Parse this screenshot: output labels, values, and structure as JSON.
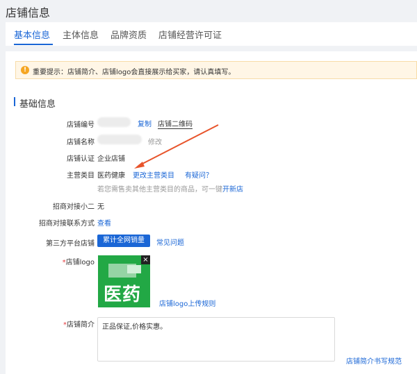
{
  "page": {
    "title": "店铺信息"
  },
  "tabs": [
    {
      "label": "基本信息"
    },
    {
      "label": "主体信息"
    },
    {
      "label": "品牌资质"
    },
    {
      "label": "店铺经营许可证"
    }
  ],
  "notice": {
    "text": "重要提示：店铺简介、店铺logo会直接展示给买家，请认真填写。"
  },
  "section": {
    "title": "基础信息"
  },
  "fields": {
    "shop_id": {
      "label": "店铺编号",
      "copy": "复制",
      "qrcode": "店铺二维码"
    },
    "shop_name": {
      "label": "店铺名称",
      "edit": "修改"
    },
    "shop_cert": {
      "label": "店铺认证",
      "value": "企业店铺"
    },
    "main_category": {
      "label": "主营类目",
      "value": "医药健康",
      "change": "更改主营类目",
      "question": "有疑问？",
      "hint": "若您需售卖其他主营类目的商品，可一键",
      "hint_link": "开新店"
    },
    "contact_staff": {
      "label": "招商对接小二",
      "value": "无"
    },
    "contact_way": {
      "label": "招商对接联系方式",
      "link": "查看"
    },
    "third_party": {
      "label": "第三方平台店铺",
      "button": "累计全网销量",
      "faq": "常见问题"
    },
    "logo": {
      "required": "*",
      "label": "店铺logo",
      "image_text": "医药",
      "close": "×",
      "rule": "店铺logo上传规则"
    },
    "intro": {
      "required": "*",
      "label": "店铺简介",
      "value": "正品保证,价格实惠。",
      "rule": "店铺简介书写规范"
    }
  },
  "colors": {
    "accent": "#1a66d6",
    "logo_bg": "#22a845",
    "arrow": "#e8542b",
    "notice_bg": "#fff6e6"
  }
}
